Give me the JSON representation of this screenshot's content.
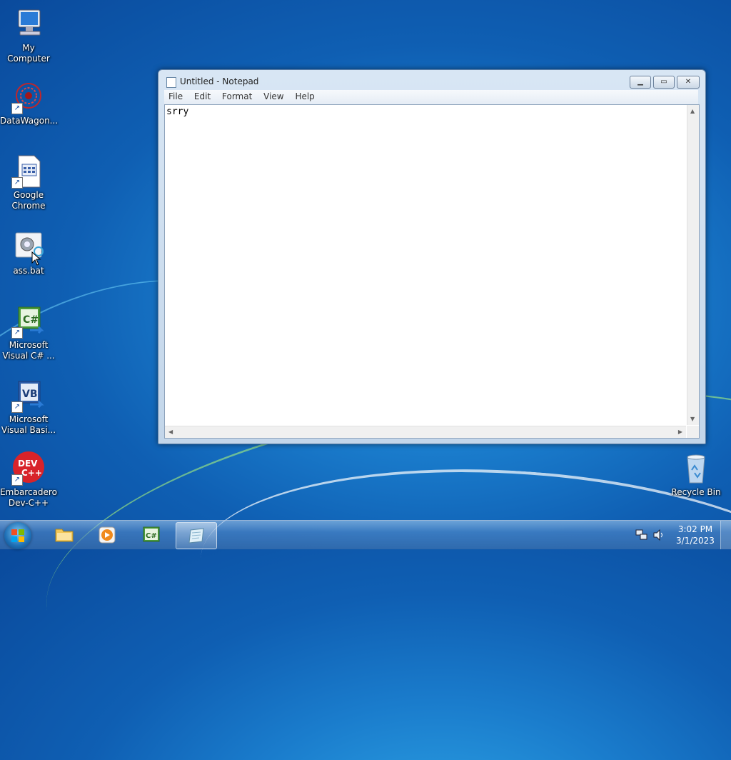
{
  "desktop": {
    "icons": [
      {
        "label": "My Computer"
      },
      {
        "label": "DataWagon..."
      },
      {
        "label": "Google Chrome"
      },
      {
        "label": "ass.bat"
      },
      {
        "label": "Microsoft Visual C# ..."
      },
      {
        "label": "Microsoft Visual Basi..."
      },
      {
        "label": "Embarcadero Dev-C++"
      },
      {
        "label": "Recycle Bin"
      }
    ]
  },
  "notepad": {
    "title": "Untitled - Notepad",
    "menu": [
      "File",
      "Edit",
      "Format",
      "View",
      "Help"
    ],
    "content": "srry"
  },
  "taskbar": {
    "items": [
      {
        "icon": "folder-icon"
      },
      {
        "icon": "media-player-icon"
      },
      {
        "icon": "visual-csharp-icon"
      },
      {
        "icon": "notepad-icon",
        "active": true
      }
    ],
    "clock": {
      "time": "3:02 PM",
      "date": "3/1/2023"
    }
  }
}
